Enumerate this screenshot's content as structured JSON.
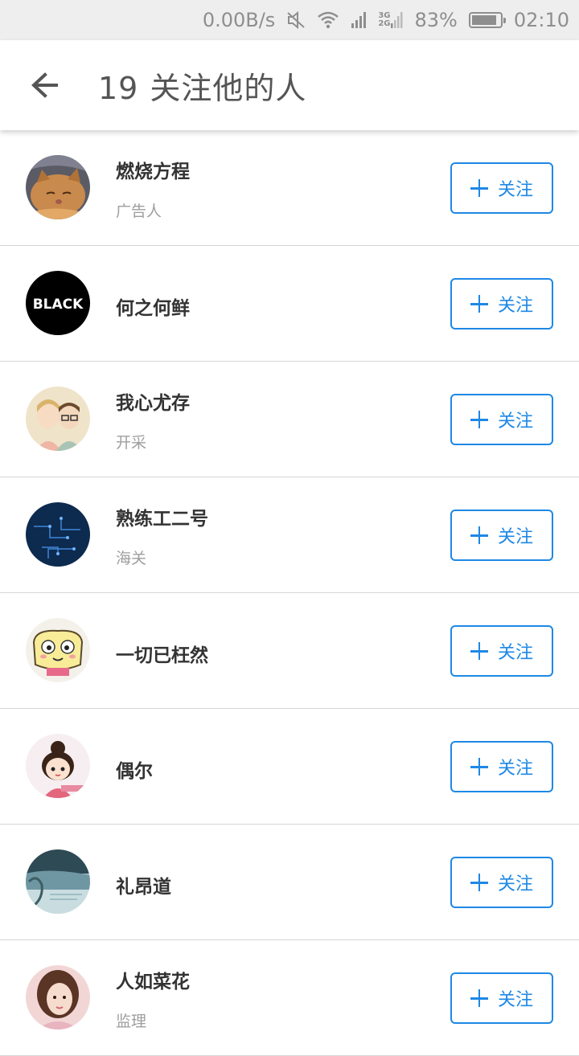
{
  "status_bar": {
    "speed": "0.00B/s",
    "net_top": "3G",
    "net_bottom": "2G",
    "battery": "83%",
    "time": "02:10"
  },
  "header": {
    "count": "19",
    "title": "关注他的人"
  },
  "follow_label": "关注",
  "users": [
    {
      "name": "燃烧方程",
      "subtitle": "广告人",
      "avatar": "cat-avatar"
    },
    {
      "name": "何之何鲜",
      "subtitle": "",
      "avatar": "black-text-avatar",
      "avatar_text": "BLACK"
    },
    {
      "name": "我心尤存",
      "subtitle": "开采",
      "avatar": "cartoon-couple-avatar"
    },
    {
      "name": "熟练工二号",
      "subtitle": "海关",
      "avatar": "circuit-avatar"
    },
    {
      "name": "一切已枉然",
      "subtitle": "",
      "avatar": "cartoon-face-avatar"
    },
    {
      "name": "偶尔",
      "subtitle": "",
      "avatar": "cartoon-girl-avatar"
    },
    {
      "name": "礼昂道",
      "subtitle": "",
      "avatar": "landscape-avatar"
    },
    {
      "name": "人如菜花",
      "subtitle": "监理",
      "avatar": "photo-girl-avatar"
    }
  ],
  "colors": {
    "accent": "#1e88e5",
    "divider": "#d6d6d6",
    "title": "#555555"
  }
}
